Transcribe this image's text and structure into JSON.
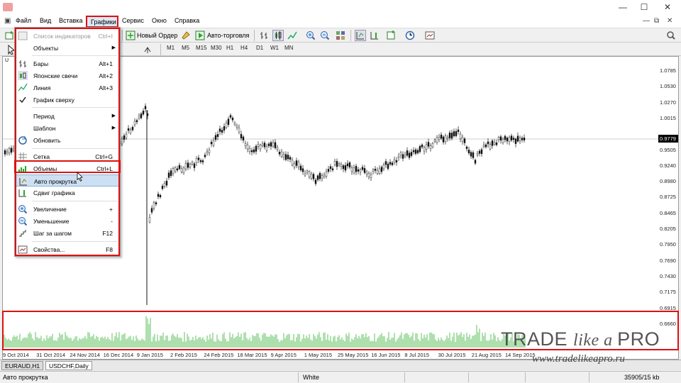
{
  "menu": {
    "items": [
      "Файл",
      "Вид",
      "Вставка",
      "Графики",
      "Сервис",
      "Окно",
      "Справка"
    ],
    "active": "Графики"
  },
  "toolbar": {
    "new_order": "Новый Ордер",
    "auto_trading": "Авто-торговля"
  },
  "periods": [
    "M1",
    "M5",
    "M15",
    "M30",
    "H1",
    "H4",
    "D1",
    "W1",
    "MN"
  ],
  "dropdown": {
    "items": [
      {
        "label": "Список индикаторов",
        "shortcut": "Ctrl+I",
        "disabled": true,
        "icon": "indicator-list-icon"
      },
      {
        "label": "Объекты",
        "submenu": true,
        "icon": ""
      },
      {
        "label": "Бары",
        "shortcut": "Alt+1",
        "icon": "bar-chart-icon"
      },
      {
        "label": "Японские свечи",
        "shortcut": "Alt+2",
        "icon": "candlestick-icon"
      },
      {
        "label": "Линия",
        "shortcut": "Alt+3",
        "icon": "line-chart-icon"
      },
      {
        "label": "График сверху",
        "checked": true,
        "icon": "check-icon"
      },
      {
        "label": "Период",
        "submenu": true,
        "icon": ""
      },
      {
        "label": "Шаблон",
        "submenu": true,
        "icon": ""
      },
      {
        "label": "Обновить",
        "icon": "refresh-icon"
      },
      {
        "label": "Сетка",
        "shortcut": "Ctrl+G",
        "icon": "grid-icon"
      },
      {
        "label": "Объемы",
        "shortcut": "Ctrl+L",
        "icon": "volumes-icon"
      },
      {
        "label": "Авто прокрутка",
        "hover": true,
        "icon": "autoscroll-icon"
      },
      {
        "label": "Сдвиг графика",
        "icon": "chart-shift-icon"
      },
      {
        "label": "Увеличение",
        "shortcut": "+",
        "icon": "zoom-in-icon"
      },
      {
        "label": "Уменьшение",
        "shortcut": "-",
        "icon": "zoom-out-icon"
      },
      {
        "label": "Шаг за шагом",
        "shortcut": "F12",
        "icon": "step-icon"
      },
      {
        "label": "Свойства...",
        "shortcut": "F8",
        "icon": "properties-icon"
      }
    ]
  },
  "chart": {
    "price_labels": [
      "1.0785",
      "1.0530",
      "1.0270",
      "1.0015",
      "0.9779",
      "0.9505",
      "0.9240",
      "0.8980",
      "0.8725",
      "0.8465",
      "0.8205",
      "0.7950",
      "0.7690",
      "0.7430",
      "0.7175",
      "0.6915",
      "0.6660"
    ],
    "current_price": "0.9779",
    "time_labels": [
      "9 Oct 2014",
      "31 Oct 2014",
      "24 Nov 2014",
      "16 Dec 2014",
      "9 Jan 2015",
      "2 Feb 2015",
      "24 Feb 2015",
      "18 Mar 2015",
      "9 Apr 2015",
      "1 May 2015",
      "25 May 2015",
      "16 Jun 2015",
      "8 Jul 2015",
      "30 Jul 2015",
      "21 Aug 2015",
      "14 Sep 2015"
    ],
    "symbol_prefix": "U"
  },
  "tabs": [
    {
      "label": "EURAUD,H1",
      "active": false
    },
    {
      "label": "USDCHF,Daily",
      "active": true
    }
  ],
  "status": {
    "left": "Авто прокрутка",
    "profile": "White",
    "traffic": "35905/15 kb"
  },
  "watermark": {
    "brand_a": "TRADE ",
    "brand_b": "like a ",
    "brand_c": "PRO",
    "url": "www.tradelikeapro.ru"
  },
  "colors": {
    "highlight_red": "#dd1111",
    "volume_green": "#5cc15c",
    "hover_blue": "#cde0f3"
  }
}
